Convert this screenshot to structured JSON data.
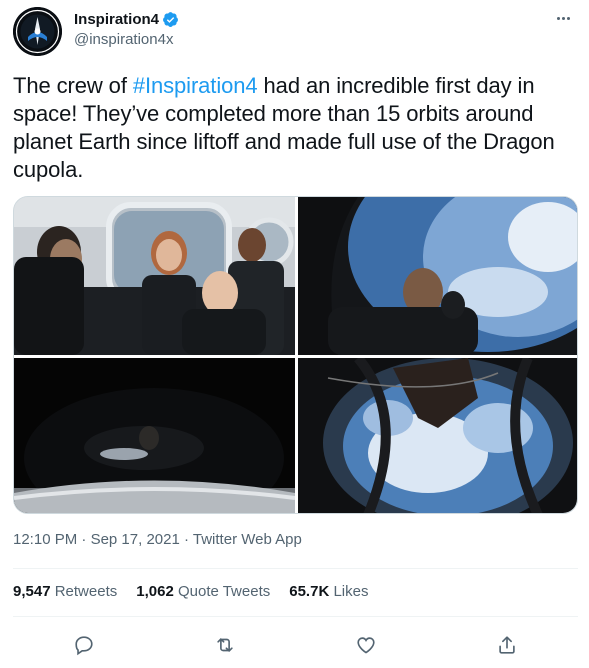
{
  "author": {
    "display_name": "Inspiration4",
    "handle": "@inspiration4x",
    "verified": true,
    "avatar_icon": "inspiration4-mission-patch"
  },
  "tweet": {
    "text_before": "The crew of ",
    "hashtag": "#Inspiration4",
    "text_after": " had an incredible first day in space! They’ve completed more than 15 orbits around planet Earth since liftoff and made full use of the Dragon cupola."
  },
  "media": {
    "photos": [
      {
        "icon": "crew-in-capsule-photo"
      },
      {
        "icon": "crew-member-at-cupola-photo"
      },
      {
        "icon": "dark-cupola-interior-photo"
      },
      {
        "icon": "earth-through-cupola-photo"
      }
    ]
  },
  "meta": {
    "time": "12:10 PM",
    "separator1": "·",
    "date": "Sep 17, 2021",
    "separator2": "·",
    "source": "Twitter Web App"
  },
  "stats": {
    "retweets_count": "9,547",
    "retweets_label": "Retweets",
    "quotes_count": "1,062",
    "quotes_label": "Quote Tweets",
    "likes_count": "65.7K",
    "likes_label": "Likes"
  },
  "actions": {
    "reply_icon": "reply-icon",
    "retweet_icon": "retweet-icon",
    "like_icon": "heart-icon",
    "share_icon": "share-icon"
  },
  "colors": {
    "text": "#0f1419",
    "secondary": "#536471",
    "accent": "#1d9bf0",
    "divider": "#eff3f4"
  }
}
